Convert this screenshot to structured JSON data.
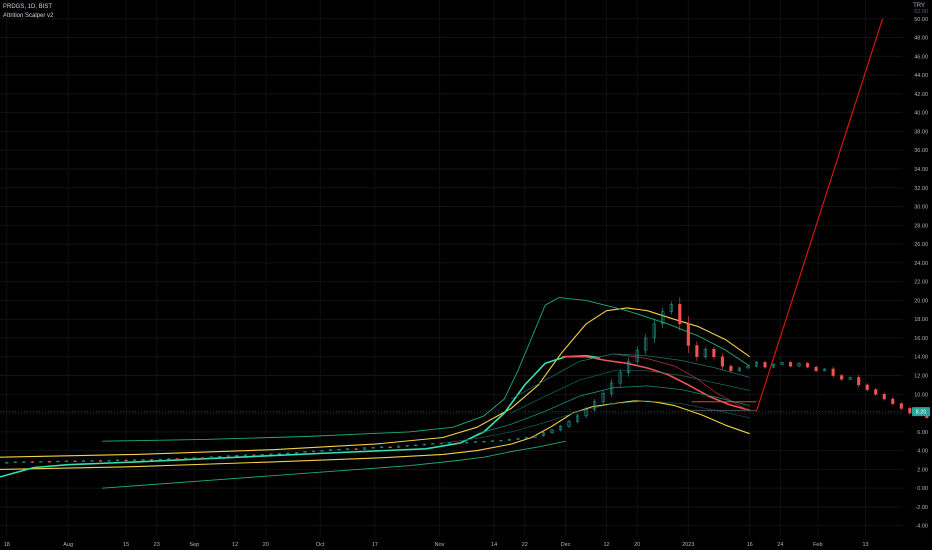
{
  "header": {
    "symbol_line": "PRDGS, 1D, BIST",
    "indicator_line": "Attrition Scalper v2",
    "currency": "TRY"
  },
  "colors": {
    "background": "#000000",
    "up": "#26a69a",
    "down": "#ef5350",
    "projection": "#e3170a",
    "yellow_band": "#f5d142",
    "green_band": "#1fae6f",
    "cyan_ma": "#38e0b0",
    "price_badge": "#26a69a"
  },
  "chart_data": {
    "type": "candlestick",
    "ylim": [
      -5.2,
      52
    ],
    "y_ticks": [
      "-4.00",
      "-2.00",
      "0.00",
      "2.00",
      "4.00",
      "6.00",
      "8.00",
      "10.00",
      "12.00",
      "14.00",
      "16.00",
      "18.00",
      "20.00",
      "22.00",
      "24.00",
      "26.00",
      "28.00",
      "30.00",
      "32.00",
      "34.00",
      "36.00",
      "38.00",
      "40.00",
      "42.00",
      "44.00",
      "46.00",
      "48.00",
      "50.00"
    ],
    "y_tick_values": [
      -4,
      -2,
      0,
      2,
      4,
      6,
      8,
      10,
      12,
      14,
      16,
      18,
      20,
      22,
      24,
      26,
      28,
      30,
      32,
      34,
      36,
      38,
      40,
      42,
      44,
      46,
      48,
      50
    ],
    "top_partial_label": "52.00",
    "xlim": [
      0,
      265
    ],
    "x_ticks": [
      {
        "label": "18",
        "x": 2
      },
      {
        "label": "Aug",
        "x": 20
      },
      {
        "label": "15",
        "x": 37
      },
      {
        "label": "23",
        "x": 46
      },
      {
        "label": "Sep",
        "x": 57
      },
      {
        "label": "12",
        "x": 69
      },
      {
        "label": "20",
        "x": 78
      },
      {
        "label": "Oct",
        "x": 94
      },
      {
        "label": "17",
        "x": 110
      },
      {
        "label": "Nov",
        "x": 129
      },
      {
        "label": "14",
        "x": 145
      },
      {
        "label": "22",
        "x": 154
      },
      {
        "label": "Dec",
        "x": 166
      },
      {
        "label": "12",
        "x": 178
      },
      {
        "label": "20",
        "x": 187
      },
      {
        "label": "2023",
        "x": 202
      },
      {
        "label": "16",
        "x": 220
      },
      {
        "label": "24",
        "x": 229
      },
      {
        "label": "Feb",
        "x": 240
      },
      {
        "label": "13",
        "x": 254
      }
    ],
    "candles_x_start": 2,
    "candles_x_step": 2.5,
    "candle_closes": [
      2.75,
      2.8,
      2.82,
      2.8,
      2.85,
      2.82,
      2.88,
      2.9,
      2.86,
      2.92,
      2.95,
      2.9,
      2.95,
      3.0,
      2.98,
      3.02,
      3.05,
      3.0,
      3.1,
      3.15,
      3.12,
      3.2,
      3.25,
      3.2,
      3.35,
      3.4,
      3.45,
      3.5,
      3.55,
      3.5,
      3.6,
      3.65,
      3.7,
      3.75,
      3.8,
      3.9,
      3.95,
      4.0,
      4.1,
      4.15,
      4.2,
      4.15,
      4.3,
      4.35,
      4.4,
      4.35,
      4.5,
      4.55,
      4.6,
      4.7,
      4.75,
      4.8,
      4.85,
      4.8,
      4.9,
      4.95,
      5.0,
      5.05,
      5.1,
      5.2,
      5.3,
      5.4,
      5.6,
      5.9,
      6.2,
      6.6,
      7.1,
      7.7,
      8.4,
      9.2,
      10.1,
      11.2,
      12.3,
      13.5,
      14.7,
      16.0,
      17.5,
      18.8,
      19.6,
      17.5,
      15.2,
      14.0,
      14.8,
      14.0,
      13.0,
      12.5,
      12.8,
      13.0,
      13.4,
      12.9,
      13.2,
      13.4,
      13.0,
      13.3,
      12.9,
      12.5,
      12.7,
      12.0,
      11.6,
      11.8,
      11.0,
      10.5,
      10.0,
      9.5,
      9.0,
      8.5,
      8.0,
      7.8,
      7.5,
      7.4,
      7.2,
      7.5,
      7.8,
      8.2
    ],
    "current_price": 8.15,
    "current_price_label": "8.20",
    "bands": {
      "yellow_upper": [
        [
          0,
          3.3
        ],
        [
          40,
          3.6
        ],
        [
          80,
          4.1
        ],
        [
          110,
          4.7
        ],
        [
          130,
          5.4
        ],
        [
          140,
          6.5
        ],
        [
          150,
          8.5
        ],
        [
          158,
          11
        ],
        [
          165,
          14.5
        ],
        [
          172,
          17.5
        ],
        [
          178,
          18.9
        ],
        [
          184,
          19.2
        ],
        [
          190,
          18.9
        ],
        [
          196,
          18.2
        ],
        [
          205,
          17.2
        ],
        [
          213,
          15.8
        ],
        [
          220,
          14.0
        ]
      ],
      "yellow_lower": [
        [
          0,
          2.0
        ],
        [
          40,
          2.3
        ],
        [
          80,
          2.8
        ],
        [
          110,
          3.2
        ],
        [
          130,
          3.6
        ],
        [
          140,
          4.0
        ],
        [
          150,
          4.7
        ],
        [
          156,
          5.4
        ],
        [
          162,
          6.6
        ],
        [
          168,
          8.0
        ],
        [
          174,
          8.7
        ],
        [
          180,
          9.0
        ],
        [
          186,
          9.3
        ],
        [
          192,
          9.2
        ],
        [
          198,
          8.8
        ],
        [
          206,
          7.8
        ],
        [
          213,
          6.7
        ],
        [
          220,
          5.8
        ]
      ],
      "green_outer_upper": [
        [
          30,
          5.0
        ],
        [
          60,
          5.2
        ],
        [
          90,
          5.5
        ],
        [
          120,
          6.0
        ],
        [
          133,
          6.5
        ],
        [
          142,
          7.7
        ],
        [
          148,
          9.5
        ],
        [
          152,
          12.5
        ],
        [
          156,
          16
        ],
        [
          160,
          19.5
        ],
        [
          164,
          20.3
        ],
        [
          172,
          20.0
        ],
        [
          184,
          18.9
        ],
        [
          196,
          17.5
        ],
        [
          205,
          16.2
        ],
        [
          213,
          14.7
        ],
        [
          220,
          13.0
        ]
      ],
      "green_outer_lower": [
        [
          30,
          0.0
        ],
        [
          60,
          0.8
        ],
        [
          90,
          1.6
        ],
        [
          120,
          2.4
        ],
        [
          133,
          2.9
        ],
        [
          142,
          3.3
        ],
        [
          150,
          3.9
        ],
        [
          158,
          4.4
        ],
        [
          166,
          5.0
        ]
      ],
      "cyan_ma": [
        [
          0,
          1.2
        ],
        [
          10,
          2.2
        ],
        [
          20,
          2.5
        ],
        [
          40,
          2.8
        ],
        [
          70,
          3.3
        ],
        [
          100,
          3.8
        ],
        [
          125,
          4.2
        ],
        [
          135,
          4.8
        ],
        [
          142,
          6.0
        ],
        [
          148,
          8.0
        ],
        [
          154,
          11.0
        ],
        [
          160,
          13.3
        ],
        [
          166,
          14.0
        ],
        [
          172,
          14.1
        ],
        [
          176,
          13.9
        ]
      ],
      "red_ma": [
        [
          165,
          14.0
        ],
        [
          172,
          14.0
        ],
        [
          178,
          13.6
        ],
        [
          184,
          13.3
        ],
        [
          190,
          12.8
        ],
        [
          196,
          12.1
        ],
        [
          202,
          11.0
        ],
        [
          208,
          9.8
        ],
        [
          214,
          8.9
        ],
        [
          220,
          8.3
        ]
      ],
      "red_thin_upper": [
        [
          180,
          14.3
        ],
        [
          190,
          13.8
        ],
        [
          198,
          13.0
        ],
        [
          204,
          11.8
        ],
        [
          210,
          10.2
        ],
        [
          216,
          9.0
        ],
        [
          220,
          8.2
        ]
      ],
      "teal_1": [
        [
          150,
          9.5
        ],
        [
          160,
          11.5
        ],
        [
          170,
          13.5
        ],
        [
          180,
          14.3
        ],
        [
          190,
          14.1
        ],
        [
          200,
          13.6
        ],
        [
          210,
          12.8
        ],
        [
          220,
          11.8
        ]
      ],
      "teal_2": [
        [
          150,
          8.0
        ],
        [
          160,
          9.8
        ],
        [
          170,
          11.5
        ],
        [
          180,
          12.5
        ],
        [
          190,
          12.5
        ],
        [
          200,
          12.0
        ],
        [
          210,
          11.2
        ],
        [
          220,
          10.4
        ]
      ],
      "teal_3": [
        [
          140,
          5.8
        ],
        [
          150,
          6.8
        ],
        [
          160,
          8.2
        ],
        [
          170,
          9.8
        ],
        [
          180,
          10.7
        ],
        [
          190,
          10.9
        ],
        [
          200,
          10.5
        ],
        [
          210,
          9.7
        ],
        [
          220,
          8.8
        ]
      ],
      "teal_4": [
        [
          130,
          4.8
        ],
        [
          140,
          5.3
        ],
        [
          150,
          6.0
        ],
        [
          160,
          7.0
        ],
        [
          170,
          8.2
        ],
        [
          180,
          9.0
        ],
        [
          190,
          9.3
        ],
        [
          200,
          9.0
        ],
        [
          210,
          8.3
        ],
        [
          220,
          7.5
        ]
      ],
      "red_flat": [
        [
          203,
          9.2
        ],
        [
          222,
          9.2
        ]
      ],
      "gray_flat": [
        [
          203,
          8.3
        ],
        [
          222,
          8.3
        ]
      ]
    },
    "projection": [
      [
        222,
        8.2
      ],
      [
        259,
        50.0
      ]
    ]
  }
}
